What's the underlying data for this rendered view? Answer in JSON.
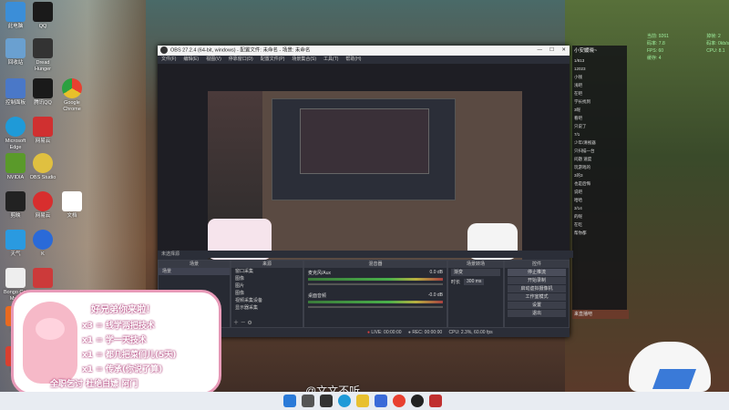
{
  "desktop": {
    "icons": [
      {
        "label": "此电脑",
        "color": "#3b8ed8"
      },
      {
        "label": "回收站",
        "color": "#6aa0d0"
      },
      {
        "label": "控制面板",
        "color": "#4a78c8"
      },
      {
        "label": "Microsoft Edge",
        "color": "#1f9ad8"
      },
      {
        "label": "NVIDIA",
        "color": "#5a9a2a"
      },
      {
        "label": "剪映",
        "color": "#222222"
      },
      {
        "label": "天气",
        "color": "#2a9ae0"
      },
      {
        "label": "Bongo Cat Mver",
        "color": "#eeeeee"
      },
      {
        "label": "火绒",
        "color": "#e86a20"
      },
      {
        "label": "日程",
        "color": "#d84030"
      }
    ],
    "icons2": [
      {
        "label": "QQ",
        "color": "#1a1a1a"
      },
      {
        "label": "Dread Hunger",
        "color": "#333333"
      },
      {
        "label": "腾讯QQ",
        "color": "#1a1a1a"
      },
      {
        "label": "网易云",
        "color": "#d03030"
      },
      {
        "label": "OBS Studio",
        "color": "#222222"
      },
      {
        "label": "网易云",
        "color": "#d82e2e"
      },
      {
        "label": "K",
        "color": "#2a6ad8"
      },
      {
        "label": "",
        "color": "#cc3a3a"
      }
    ],
    "icons3": [
      {
        "label": "Google Chrome",
        "color": "#e8c02a"
      },
      {
        "label": "文档",
        "color": "#ffffff"
      }
    ]
  },
  "obs": {
    "title": "OBS 27.2.4 (64-bit, windows) - 配置文件: 未命名 - 场景: 未命名",
    "menu": [
      "文件(F)",
      "编辑(E)",
      "视图(V)",
      "停靠窗口(D)",
      "配置文件(P)",
      "场景集合(S)",
      "工具(T)",
      "帮助(H)"
    ],
    "preview_label": "未选择源",
    "docks": {
      "scenes": {
        "title": "场景",
        "items": [
          "场景"
        ]
      },
      "sources": {
        "title": "来源",
        "items": [
          "窗口采集",
          "图像",
          "图片",
          "图像",
          "视频采集设备",
          "显示器采集"
        ]
      },
      "mixer": {
        "title": "混音器",
        "channels": [
          {
            "name": "麦克风/Aux",
            "db": "0.0 dB"
          },
          {
            "name": "桌面音频",
            "db": "-0.0 dB"
          }
        ]
      },
      "transitions": {
        "title": "场景转场",
        "type": "渐变",
        "duration_label": "时长",
        "duration": "300 ms"
      },
      "controls": {
        "title": "控件",
        "buttons": [
          "停止推流",
          "开始录制",
          "启动虚拟摄像机",
          "工作室模式",
          "设置",
          "退出"
        ]
      }
    },
    "status": {
      "live": "LIVE: 00:00:00",
      "rec": "REC: 00:00:00",
      "cpu": "CPU: 2.3%, 60.00 fps"
    }
  },
  "chat": {
    "title": "小安媛晓~",
    "lines": [
      "1/813",
      "12023",
      "小钱",
      "浅吧",
      "在吧",
      "学长找到",
      "3呢",
      "看吧",
      "只说了",
      "7/1",
      "少年/清视器",
      "只扫描一台",
      "问题 速度",
      "玩游戏的",
      "3的3",
      "也是后悔",
      "说吧",
      "哈哈",
      "3/14",
      "的呢",
      "在吃",
      "帮你都"
    ],
    "footer": "来直播吧"
  },
  "stats": {
    "lines": [
      "当前: 9261",
      "码率: 7.8",
      "FPS: 60",
      "缓存: 4"
    ],
    "lines2": [
      "掉帧: 2",
      "码率: 0kb/s",
      "CPU: 8.1"
    ]
  },
  "sticker": {
    "lines": [
      "好兄弟你来啦！",
      "x3 = 线学两把技术",
      "x1 = 学一天技术",
      "x1 = 都几把菜们儿(5天)",
      "x1 = 传承(你说了算)",
      "全职乞讨 杜绝白嫖 阿门"
    ]
  },
  "watermark": "@文文不听",
  "colors": {
    "obs_bg": "#2b2e38",
    "accent": "#4ab04a",
    "sticker_border": "#e89ab8"
  }
}
